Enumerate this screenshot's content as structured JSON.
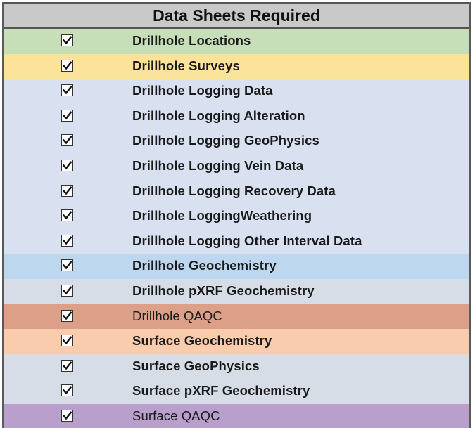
{
  "header": {
    "title": "Data Sheets Required"
  },
  "rows": [
    {
      "label": "Drillhole Locations",
      "checked": true,
      "bg": "#c6dfb8",
      "bold": true
    },
    {
      "label": "Drillhole Surveys",
      "checked": true,
      "bg": "#fde39a",
      "bold": true
    },
    {
      "label": "Drillhole Logging Data",
      "checked": true,
      "bg": "#d9e1f1",
      "bold": true
    },
    {
      "label": "Drillhole Logging Alteration",
      "checked": true,
      "bg": "#d9e1f1",
      "bold": true
    },
    {
      "label": "Drillhole Logging GeoPhysics",
      "checked": true,
      "bg": "#d9e1f1",
      "bold": true
    },
    {
      "label": "Drillhole Logging Vein Data",
      "checked": true,
      "bg": "#d9e1f1",
      "bold": true
    },
    {
      "label": "Drillhole Logging Recovery Data",
      "checked": true,
      "bg": "#d9e1f1",
      "bold": true
    },
    {
      "label": "Drillhole LoggingWeathering",
      "checked": true,
      "bg": "#d9e1f1",
      "bold": true
    },
    {
      "label": "Drillhole Logging Other Interval Data",
      "checked": true,
      "bg": "#d9e1f1",
      "bold": true
    },
    {
      "label": "Drillhole Geochemistry",
      "checked": true,
      "bg": "#bcd7ee",
      "bold": true
    },
    {
      "label": "Drillhole pXRF Geochemistry",
      "checked": true,
      "bg": "#d6dde6",
      "bold": true
    },
    {
      "label": "Drillhole QAQC",
      "checked": true,
      "bg": "#dba087",
      "bold": false
    },
    {
      "label": "Surface Geochemistry",
      "checked": true,
      "bg": "#f9ccae",
      "bold": true
    },
    {
      "label": "Surface GeoPhysics",
      "checked": true,
      "bg": "#d6dde6",
      "bold": true
    },
    {
      "label": "Surface pXRF Geochemistry",
      "checked": true,
      "bg": "#d6dde6",
      "bold": true
    },
    {
      "label": "Surface  QAQC",
      "checked": true,
      "bg": "#b99fcc",
      "bold": false
    }
  ]
}
